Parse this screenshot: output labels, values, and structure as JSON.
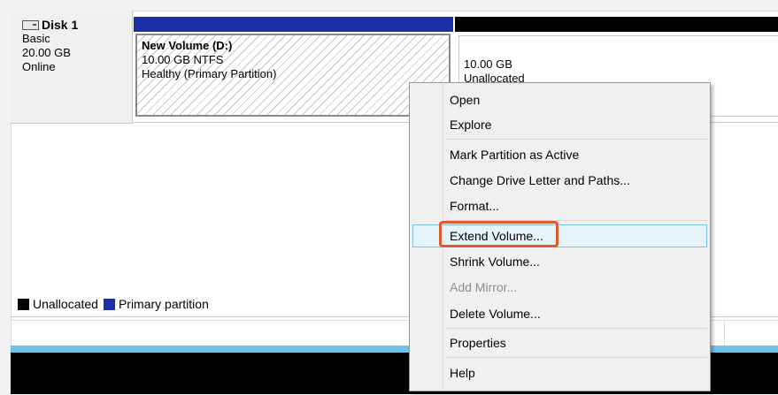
{
  "disk": {
    "title": "Disk 1",
    "type": "Basic",
    "size": "20.00 GB",
    "status": "Online"
  },
  "partitions": {
    "primary": {
      "name": "New Volume  (D:)",
      "size_fs": "10.00 GB NTFS",
      "status": "Healthy (Primary Partition)"
    },
    "unallocated": {
      "size": "10.00 GB",
      "label": "Unallocated"
    }
  },
  "legend": {
    "unallocated": "Unallocated",
    "primary": "Primary partition"
  },
  "context_menu": {
    "items": [
      {
        "label": "Open"
      },
      {
        "label": "Explore"
      },
      {
        "label": "Mark Partition as Active"
      },
      {
        "label": "Change Drive Letter and Paths..."
      },
      {
        "label": "Format..."
      },
      {
        "label": "Extend Volume..."
      },
      {
        "label": "Shrink Volume..."
      },
      {
        "label": "Add Mirror..."
      },
      {
        "label": "Delete Volume..."
      },
      {
        "label": "Properties"
      },
      {
        "label": "Help"
      }
    ]
  },
  "colors": {
    "primary_partition": "#1b2fa8",
    "unallocated": "#000000",
    "highlight": "#e05a2b",
    "menu_hover": "#e5f3fb"
  }
}
